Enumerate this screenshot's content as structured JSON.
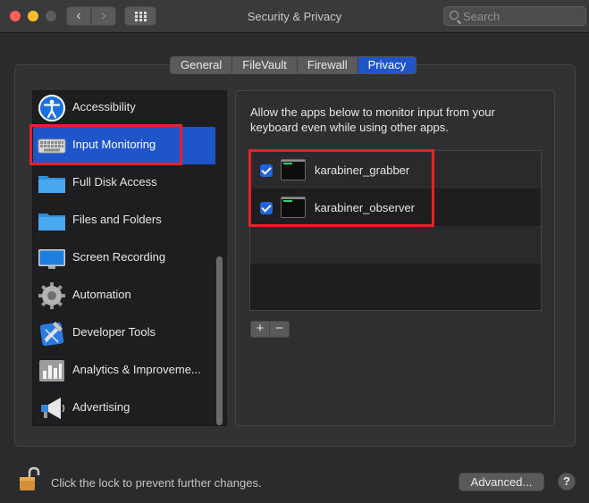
{
  "window": {
    "title": "Security & Privacy",
    "back_glyph": "‹",
    "forward_glyph": "›"
  },
  "search": {
    "placeholder": "Search",
    "value": ""
  },
  "tabs": [
    {
      "label": "General",
      "active": false
    },
    {
      "label": "FileVault",
      "active": false
    },
    {
      "label": "Firewall",
      "active": false
    },
    {
      "label": "Privacy",
      "active": true
    }
  ],
  "sidebar": {
    "items": [
      {
        "label": "Accessibility",
        "icon": "accessibility-icon",
        "selected": false
      },
      {
        "label": "Input Monitoring",
        "icon": "keyboard-icon",
        "selected": true
      },
      {
        "label": "Full Disk Access",
        "icon": "folder-icon",
        "selected": false
      },
      {
        "label": "Files and Folders",
        "icon": "folder-icon",
        "selected": false
      },
      {
        "label": "Screen Recording",
        "icon": "display-icon",
        "selected": false
      },
      {
        "label": "Automation",
        "icon": "gear-icon",
        "selected": false
      },
      {
        "label": "Developer Tools",
        "icon": "developer-tools-icon",
        "selected": false
      },
      {
        "label": "Analytics & Improveme...",
        "icon": "analytics-icon",
        "selected": false
      },
      {
        "label": "Advertising",
        "icon": "megaphone-icon",
        "selected": false
      }
    ]
  },
  "detail": {
    "description": "Allow the apps below to monitor input from your keyboard even while using other apps.",
    "apps": [
      {
        "name": "karabiner_grabber",
        "checked": true,
        "icon": "terminal-icon"
      },
      {
        "name": "karabiner_observer",
        "checked": true,
        "icon": "terminal-icon"
      }
    ],
    "add_label": "+",
    "remove_label": "−"
  },
  "footer": {
    "lock_text": "Click the lock to prevent further changes.",
    "advanced_label": "Advanced...",
    "help_label": "?"
  },
  "colors": {
    "accent": "#1e56c9",
    "highlight": "#e8202a",
    "background": "#2b2b2d"
  }
}
